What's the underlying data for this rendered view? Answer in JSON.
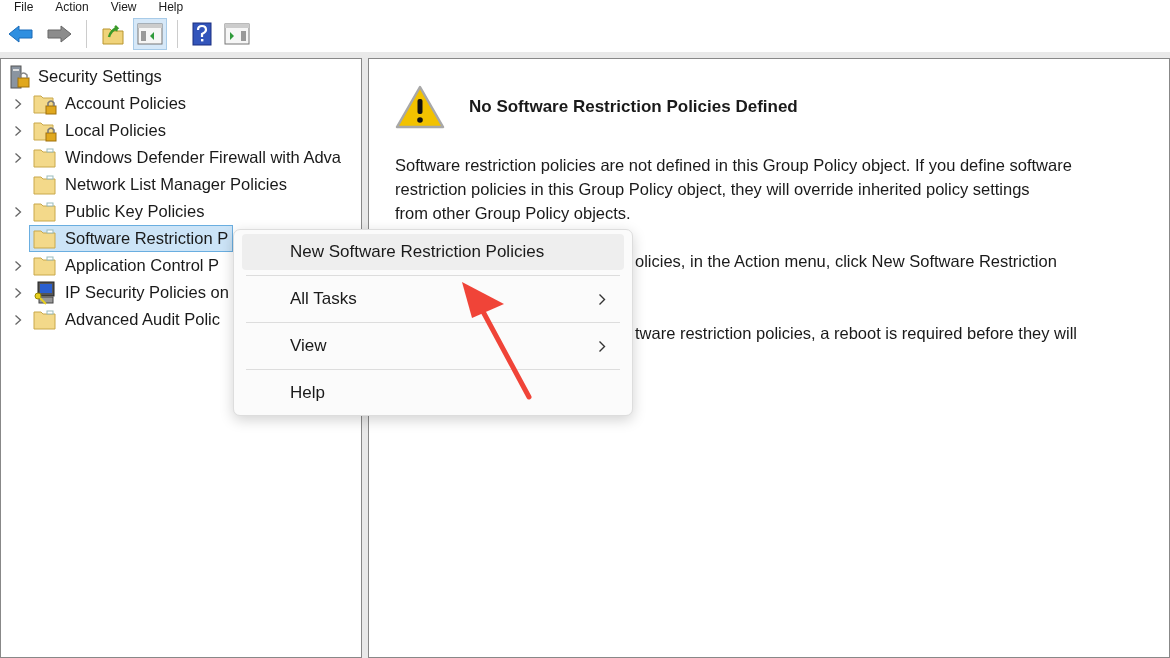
{
  "menu_bar": [
    {
      "label": "File"
    },
    {
      "label": "Action"
    },
    {
      "label": "View"
    },
    {
      "label": "Help"
    }
  ],
  "toolbar": [
    {
      "kind": "back",
      "pressed": false
    },
    {
      "kind": "forward",
      "pressed": false
    },
    {
      "kind": "up",
      "pressed": false
    },
    {
      "kind": "tree",
      "pressed": true
    },
    {
      "kind": "help",
      "pressed": false
    },
    {
      "kind": "action",
      "pressed": false
    }
  ],
  "tree": {
    "root": {
      "label": "Security Settings"
    },
    "children": [
      {
        "label": "Account Policies",
        "kind": "lock-folder",
        "expandable": true,
        "selected": false
      },
      {
        "label": "Local Policies",
        "kind": "lock-folder",
        "expandable": true,
        "selected": false
      },
      {
        "label": "Windows Defender Firewall with Adva",
        "kind": "folder",
        "expandable": true,
        "selected": false
      },
      {
        "label": "Network List Manager Policies",
        "kind": "folder",
        "expandable": false,
        "selected": false
      },
      {
        "label": "Public Key Policies",
        "kind": "folder",
        "expandable": true,
        "selected": false
      },
      {
        "label": "Software Restriction P",
        "kind": "folder",
        "expandable": false,
        "selected": true
      },
      {
        "label": "Application Control P",
        "kind": "folder",
        "expandable": true,
        "selected": false
      },
      {
        "label": "IP Security Policies on",
        "kind": "network",
        "expandable": true,
        "selected": false
      },
      {
        "label": "Advanced Audit Polic",
        "kind": "folder",
        "expandable": true,
        "selected": false
      }
    ]
  },
  "details": {
    "title": "No Software Restriction Policies Defined",
    "paragraphs": [
      {
        "lines": [
          "Software restriction policies are not defined in this Group Policy object. If you define software",
          "restriction policies in this Group Policy object, they will override inherited policy settings",
          "from other Group Policy objects."
        ],
        "covered": false
      },
      {
        "lines": [
          "olicies, in the Action menu, click New Software Restriction"
        ],
        "covered": true
      },
      {
        "lines": [
          "tware restriction policies, a reboot is required before they will"
        ],
        "covered": true
      }
    ]
  },
  "context_menu": [
    {
      "label": "New Software Restriction Policies",
      "submenu": false,
      "highlighted": true
    },
    {
      "label": "All Tasks",
      "submenu": true,
      "highlighted": false
    },
    {
      "label": "View",
      "submenu": true,
      "highlighted": false
    },
    {
      "label": "Help",
      "submenu": false,
      "highlighted": false
    }
  ]
}
